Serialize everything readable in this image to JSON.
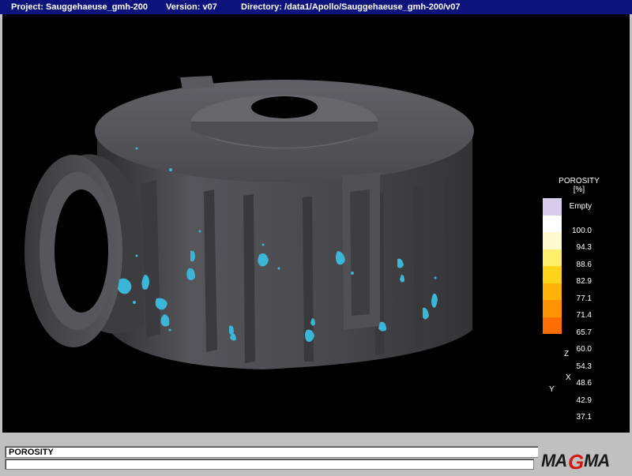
{
  "window": {
    "project": "Project: Sauggehaeuse_gmh-200",
    "version": "Version: v07",
    "directory": "Directory: /data1/Apollo/Sauggehaeuse_gmh-200/v07"
  },
  "legend": {
    "title_line1": "POROSITY",
    "title_line2": "[%]",
    "entries": [
      {
        "label": "Empty",
        "color": "#d8ccec"
      },
      {
        "label": "100.0",
        "color": "#ffffff"
      },
      {
        "label": "94.3",
        "color": "#fffbd0"
      },
      {
        "label": "88.6",
        "color": "#ffef6a"
      },
      {
        "label": "82.9",
        "color": "#ffd21c"
      },
      {
        "label": "77.1",
        "color": "#ffb308"
      },
      {
        "label": "71.4",
        "color": "#ff9303"
      },
      {
        "label": "65.7",
        "color": "#ff6e00"
      },
      {
        "label": "60.0",
        "color": ""
      },
      {
        "label": "54.3",
        "color": ""
      },
      {
        "label": "48.6",
        "color": ""
      },
      {
        "label": "42.9",
        "color": ""
      },
      {
        "label": "37.1",
        "color": ""
      }
    ]
  },
  "axes": {
    "x": "X",
    "y": "Y",
    "z": "Z"
  },
  "status": {
    "field_label": "POROSITY",
    "field2": ""
  },
  "logo": {
    "text": "MAGMA"
  },
  "colors": {
    "titlebar": "#0d137d",
    "porosity_blob": "#3bb6d6",
    "casting": "#4a4a4c"
  }
}
